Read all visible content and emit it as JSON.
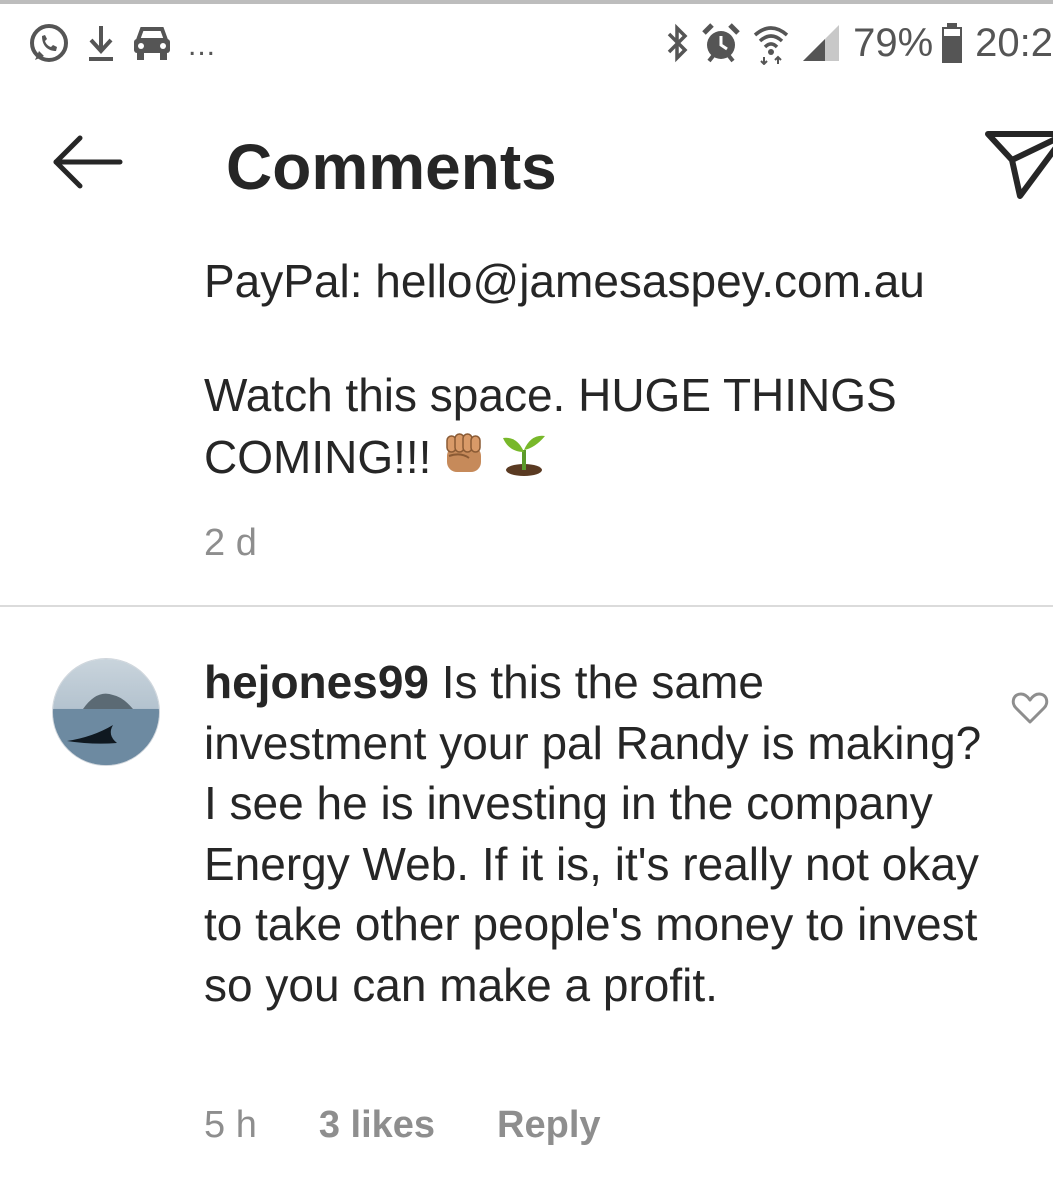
{
  "status_bar": {
    "left_icons": [
      "whatsapp-icon",
      "download-icon",
      "car-icon"
    ],
    "overflow": "...",
    "right_icons": [
      "bluetooth-icon",
      "alarm-icon",
      "wifi-icon",
      "signal-icon",
      "battery-icon"
    ],
    "battery": "79%",
    "time": "20:2"
  },
  "header": {
    "title": "Comments",
    "back_icon": "arrow-left-icon",
    "share_icon": "paper-plane-icon"
  },
  "caption": {
    "lines": [
      "PayPal: hello@jamesaspey.com.au",
      "Watch this space. HUGE THINGS",
      "COMING!!!"
    ],
    "emojis": [
      "raised-fist-emoji",
      "seedling-emoji"
    ],
    "time": "2 d"
  },
  "comment": {
    "avatar": "whale-fin-avatar",
    "username": "hejones99",
    "text": " Is this the same investment your pal Randy is making? I see he is investing in the company Energy Web. If it is, it's really not okay to take other people's money to invest so you can make a profit.",
    "time": "5 h",
    "likes": "3 likes",
    "reply": "Reply",
    "like_icon": "heart-outline-icon"
  },
  "colors": {
    "text": "#262626",
    "secondary": "#8e8e8e",
    "divider": "#dbdbdb",
    "status_icons": "#555555"
  }
}
